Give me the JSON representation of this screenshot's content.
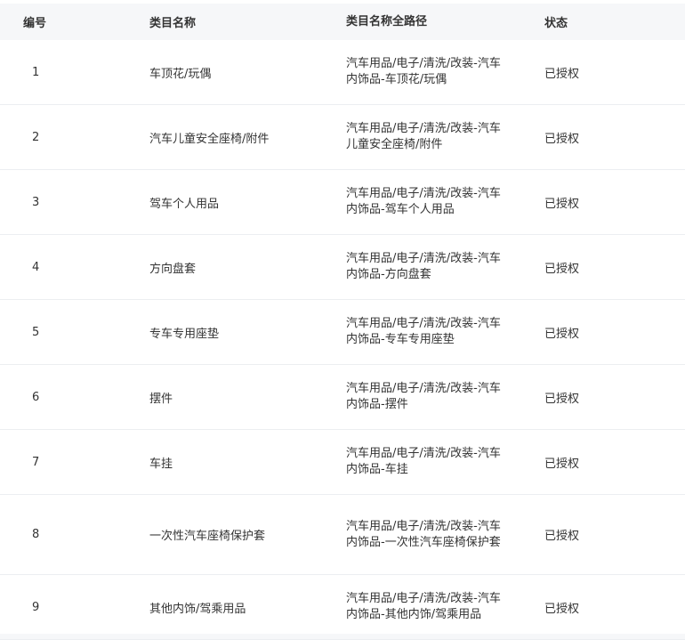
{
  "table": {
    "headers": {
      "id": "编号",
      "name": "类目名称",
      "path": "类目名称全路径",
      "status": "状态"
    },
    "rows": [
      {
        "id": "1",
        "name": "车顶花/玩偶",
        "path": "汽车用品/电子/清洗/改装-汽车内饰品-车顶花/玩偶",
        "status": "已授权"
      },
      {
        "id": "2",
        "name": "汽车儿童安全座椅/附件",
        "path": "汽车用品/电子/清洗/改装-汽车儿童安全座椅/附件",
        "status": "已授权"
      },
      {
        "id": "3",
        "name": "驾车个人用品",
        "path": "汽车用品/电子/清洗/改装-汽车内饰品-驾车个人用品",
        "status": "已授权"
      },
      {
        "id": "4",
        "name": "方向盘套",
        "path": "汽车用品/电子/清洗/改装-汽车内饰品-方向盘套",
        "status": "已授权"
      },
      {
        "id": "5",
        "name": "专车专用座垫",
        "path": "汽车用品/电子/清洗/改装-汽车内饰品-专车专用座垫",
        "status": "已授权"
      },
      {
        "id": "6",
        "name": "摆件",
        "path": "汽车用品/电子/清洗/改装-汽车内饰品-摆件",
        "status": "已授权"
      },
      {
        "id": "7",
        "name": "车挂",
        "path": "汽车用品/电子/清洗/改装-汽车内饰品-车挂",
        "status": "已授权"
      },
      {
        "id": "8",
        "name": "一次性汽车座椅保护套",
        "path": "汽车用品/电子/清洗/改装-汽车内饰品-一次性汽车座椅保护套",
        "status": "已授权"
      },
      {
        "id": "9",
        "name": "其他内饰/驾乘用品",
        "path": "汽车用品/电子/清洗/改装-汽车内饰品-其他内饰/驾乘用品",
        "status": "已授权"
      }
    ]
  }
}
